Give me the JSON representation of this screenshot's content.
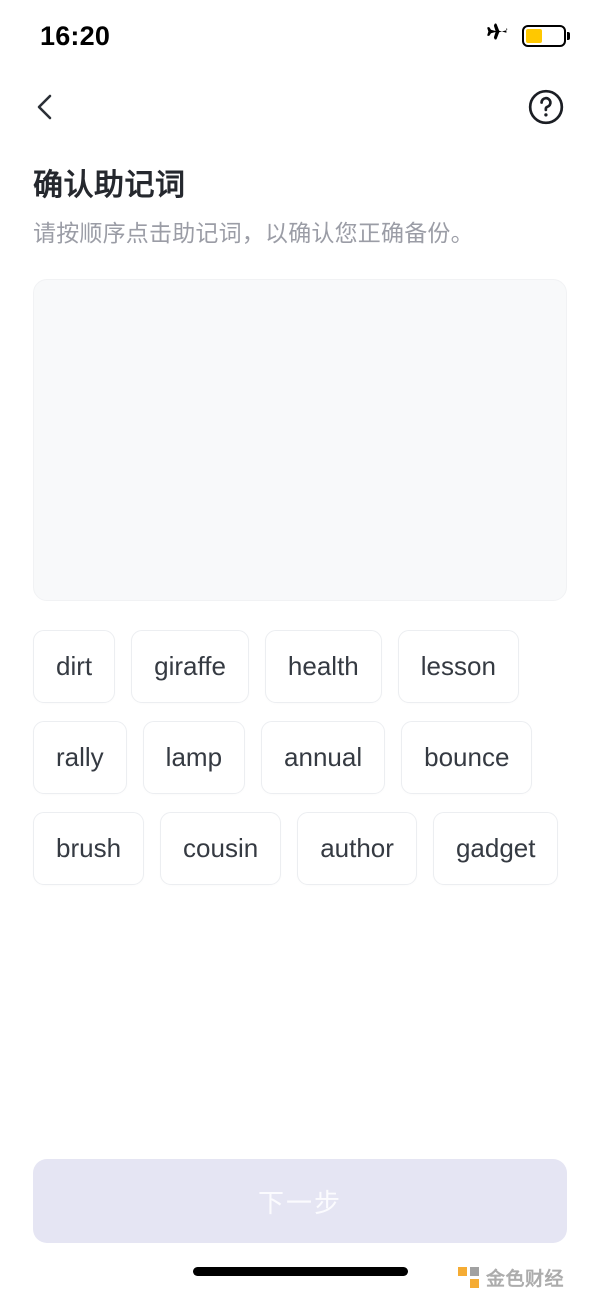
{
  "statusbar": {
    "time": "16:20",
    "airplane_icon": "airplane-icon",
    "battery_icon": "battery-icon",
    "battery_level_percent": 45,
    "battery_color": "#FFC800"
  },
  "navbar": {
    "back_icon": "chevron-left-icon",
    "help_icon": "question-circle-icon"
  },
  "heading": {
    "title": "确认助记词",
    "subtitle": "请按顺序点击助记词，以确认您正确备份。"
  },
  "answer_panel": {
    "selected_words": [],
    "background_color": "#f8f9fa"
  },
  "word_pool": {
    "words": [
      "dirt",
      "giraffe",
      "health",
      "lesson",
      "rally",
      "lamp",
      "annual",
      "bounce",
      "brush",
      "cousin",
      "author",
      "gadget"
    ]
  },
  "footer": {
    "next_label": "下一步",
    "next_enabled": false,
    "next_bg_color": "#e5e5f3"
  },
  "watermark": {
    "text": "金色财经",
    "accent_color": "#F5A623",
    "secondary_color": "#9a9a9a"
  }
}
